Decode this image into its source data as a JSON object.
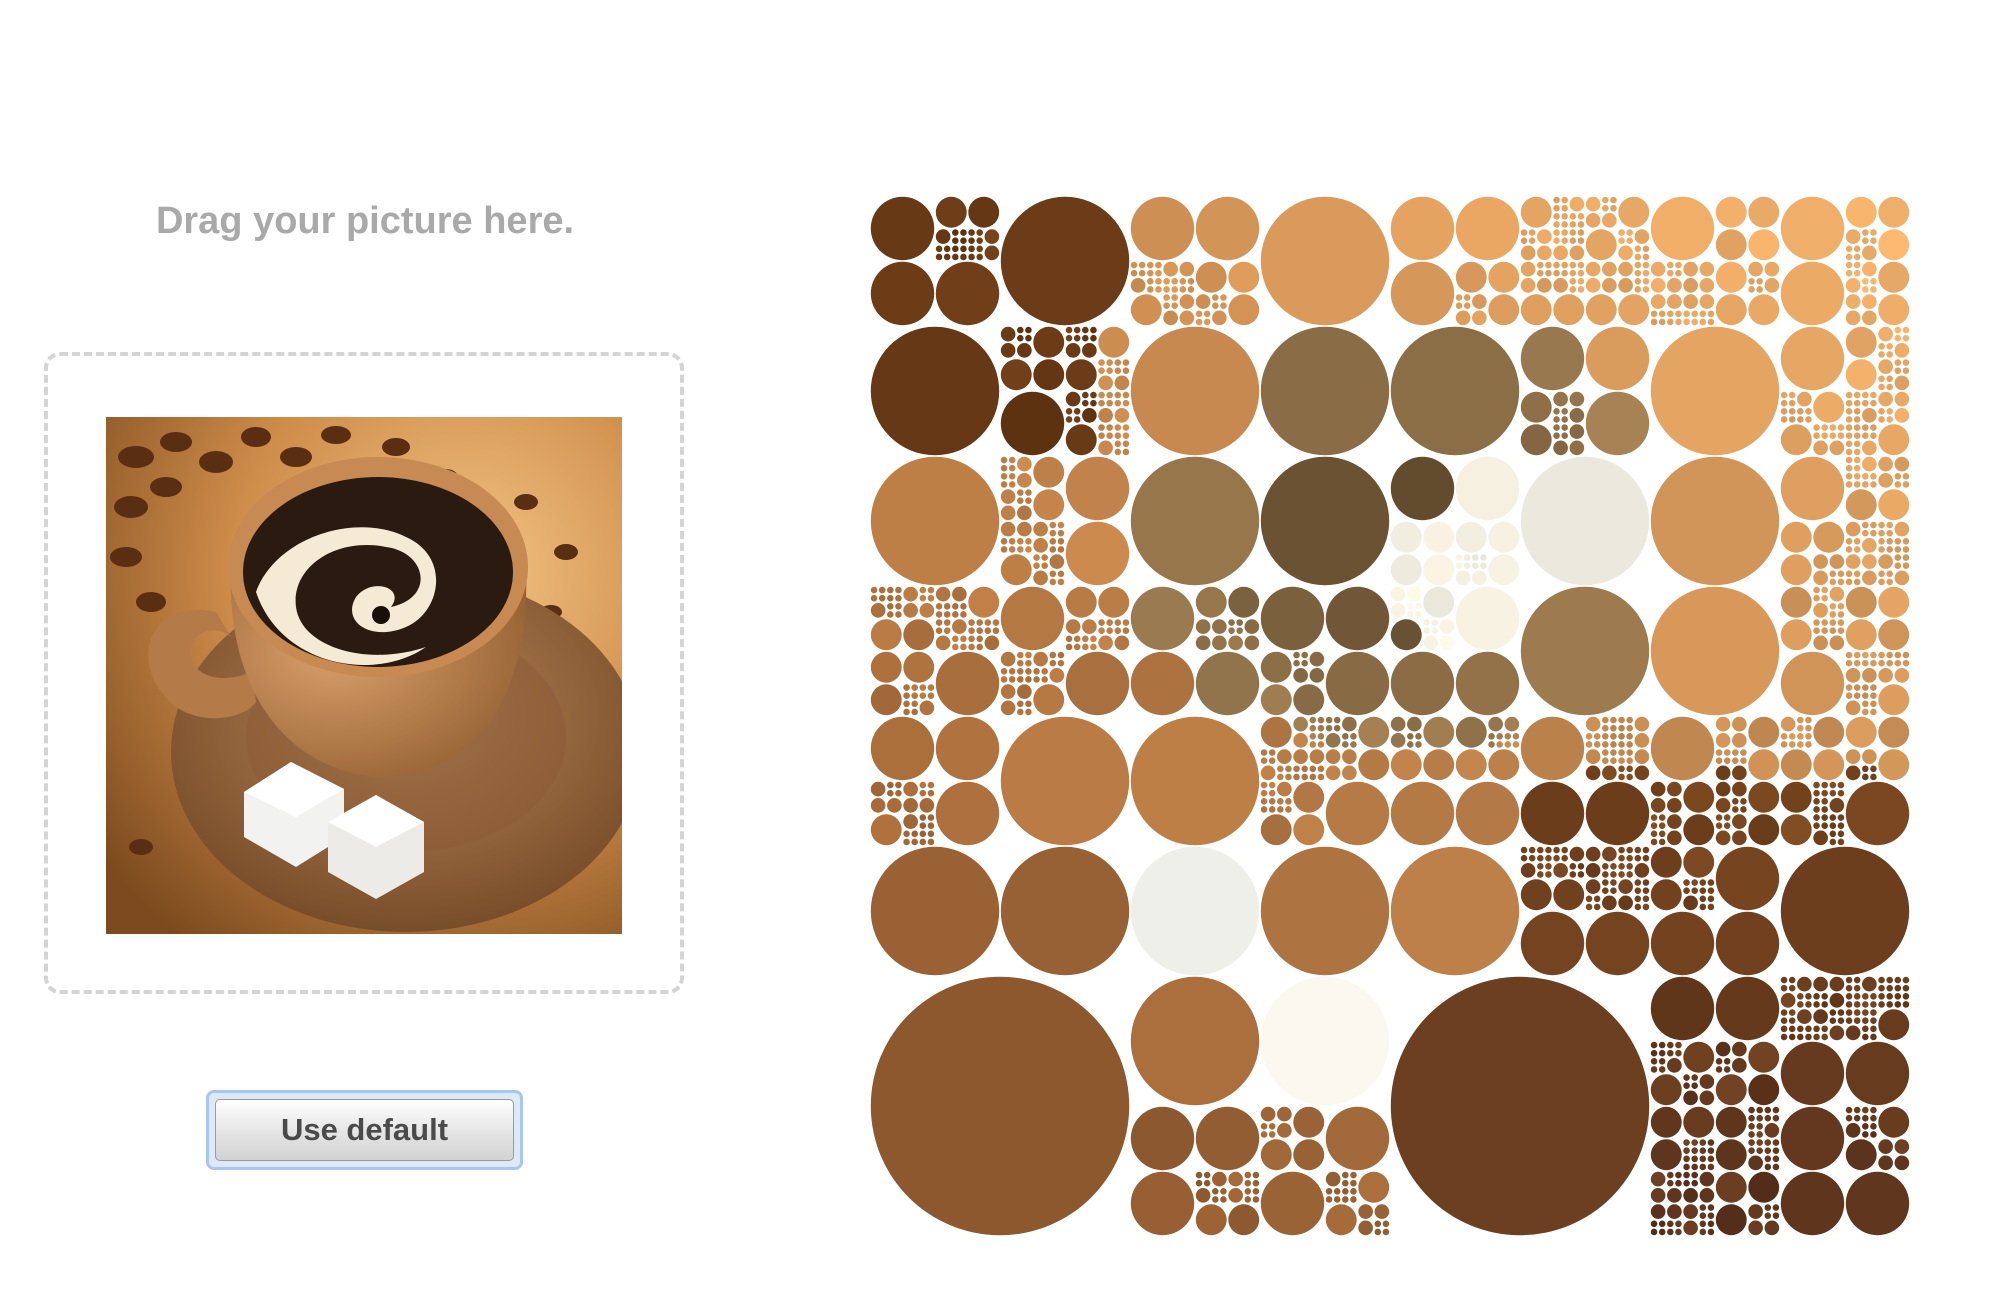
{
  "prompt_text": "Drag your picture here.",
  "default_button_label": "Use default",
  "colors": {
    "prompt_text": "#a9a9a9",
    "dropzone_border": "#d4d4d4",
    "button_focus_ring": "#a9c7ec"
  }
}
